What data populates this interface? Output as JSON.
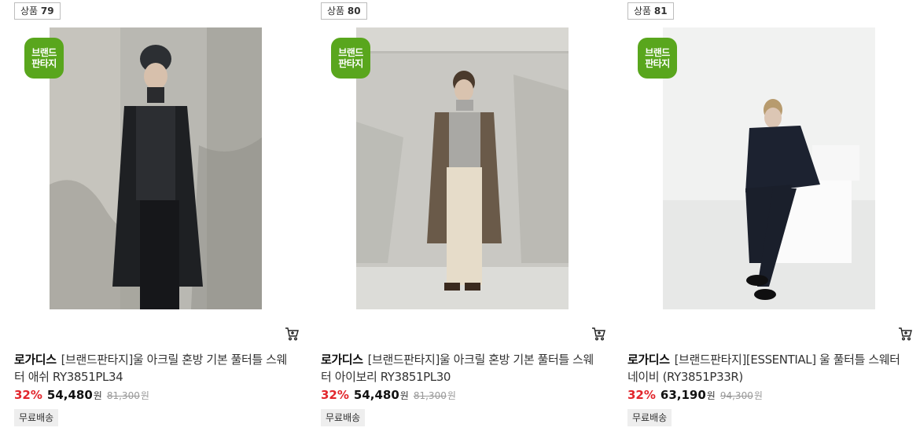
{
  "brand_badge": {
    "line1": "브랜드",
    "line2": "판타지",
    "color": "#59a61d"
  },
  "colors": {
    "discount": "#e2262c"
  },
  "products": [
    {
      "number_label": "상품",
      "number": "79",
      "brand": "로가디스",
      "name": "[브랜드판타지]울 아크릴 혼방 기본 풀터틀 스웨터 애쉬 RY3851PL34",
      "discount": "32%",
      "price": "54,480",
      "currency": "원",
      "original_price": "81,300",
      "shipping": "무료배송",
      "photo_icon": "model-black-coat-photo",
      "cart_icon": "cart-icon"
    },
    {
      "number_label": "상품",
      "number": "80",
      "brand": "로가디스",
      "name": "[브랜드판타지]울 아크릴 혼방 기본 풀터틀 스웨터 아이보리 RY3851PL30",
      "discount": "32%",
      "price": "54,480",
      "currency": "원",
      "original_price": "81,300",
      "shipping": "무료배송",
      "photo_icon": "model-brown-coat-photo",
      "cart_icon": "cart-icon"
    },
    {
      "number_label": "상품",
      "number": "81",
      "brand": "로가디스",
      "name": "[브랜드판타지][ESSENTIAL] 울 풀터틀 스웨터 네이비 (RY3851P33R)",
      "discount": "32%",
      "price": "63,190",
      "currency": "원",
      "original_price": "94,300",
      "shipping": "무료배송",
      "photo_icon": "model-navy-jacket-photo",
      "cart_icon": "cart-icon"
    }
  ]
}
